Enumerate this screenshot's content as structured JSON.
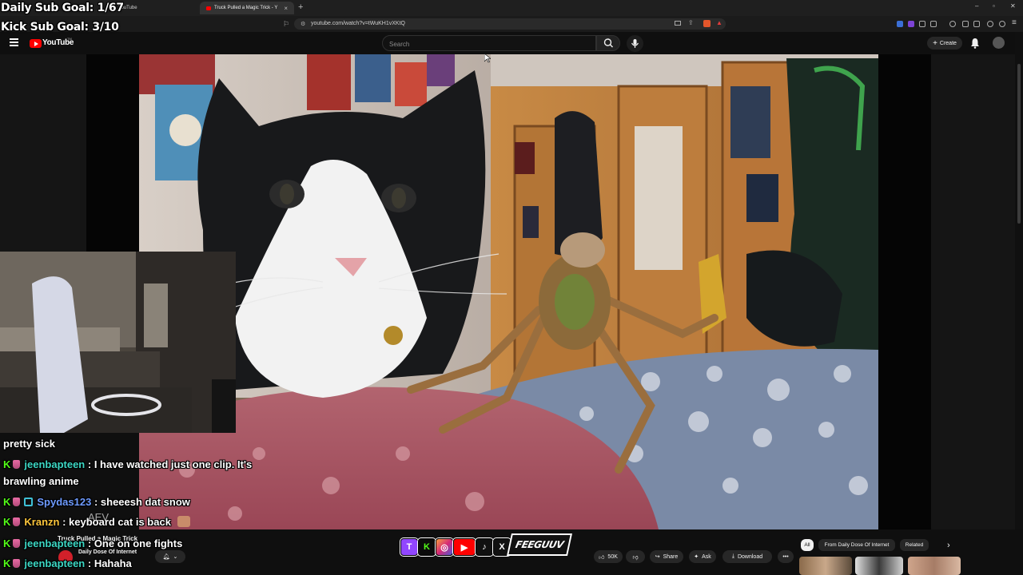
{
  "overlay": {
    "daily_goal": "Daily Sub Goal: 1/67",
    "kick_goal": "Kick Sub Goal: 3/10",
    "brand": "FEEGUUV"
  },
  "browser": {
    "tabs": [
      {
        "title": "YouTube"
      },
      {
        "title": "Truck Pulled a Magic Trick - Y"
      }
    ],
    "url": "youtube.com/watch?v=tWuKH1vXKtQ"
  },
  "youtube": {
    "logo_text": "YouTube",
    "logo_tm": "TM",
    "search_placeholder": "Search",
    "create_label": "Create"
  },
  "chat": [
    {
      "user": "",
      "message": "pretty sick"
    },
    {
      "user": "jeenbapteen",
      "message": ": I have watched just one clip. It's"
    },
    {
      "user": "",
      "message": "brawling anime"
    },
    {
      "user": "Spydas123",
      "message": ": sheeesh dat snow"
    },
    {
      "user": "Kranzn",
      "message": ": keyboard cat is back"
    },
    {
      "user": "jeenbapteen",
      "message": ": One on one fights"
    },
    {
      "user": "jeenbapteen",
      "message": ": Hahaha"
    }
  ],
  "video_info": {
    "title": "Truck Pulled a Magic Trick",
    "channel": "Daily Dose Of Internet",
    "watermark": "AEV"
  },
  "actions": {
    "likes": "50K",
    "share": "Share",
    "ask": "Ask",
    "download": "Download"
  },
  "chips": [
    "All",
    "From Daily Dose Of Internet",
    "Related"
  ],
  "colors": {
    "youtube_red": "#ff0000",
    "kick_green": "#53fc18",
    "twitch_purple": "#9146ff"
  }
}
